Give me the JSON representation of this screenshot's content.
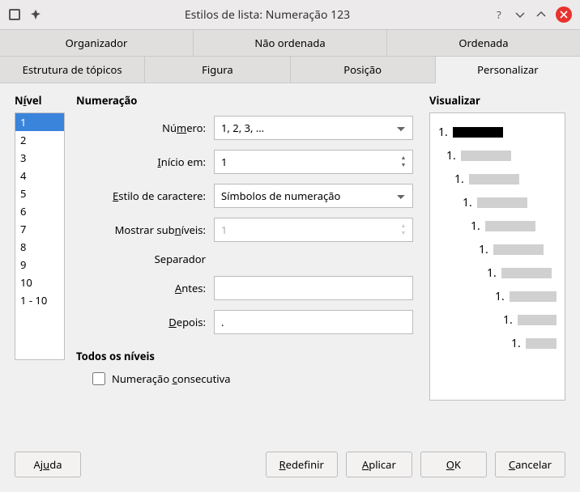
{
  "titlebar": {
    "title": "Estilos de lista: Numeração 123"
  },
  "tabs_row1": [
    {
      "label": "Organizador"
    },
    {
      "label": "Não ordenada"
    },
    {
      "label": "Ordenada"
    }
  ],
  "tabs_row2": [
    {
      "label": "Estrutura de tópicos"
    },
    {
      "label": "Figura"
    },
    {
      "label": "Posição"
    },
    {
      "label": "Personalizar",
      "active": true
    }
  ],
  "level": {
    "header_pre": "N",
    "header_u": "í",
    "header_post": "vel",
    "items": [
      "1",
      "2",
      "3",
      "4",
      "5",
      "6",
      "7",
      "8",
      "9",
      "10",
      "1 - 10"
    ],
    "selected": "1"
  },
  "numbering": {
    "header": "Numeração",
    "number_label_pre": "Nú",
    "number_label_u": "m",
    "number_label_post": "ero:",
    "number_value": "1, 2, 3, …",
    "start_label_pre": "",
    "start_label_u": "I",
    "start_label_post": "nício em:",
    "start_value": "1",
    "charstyle_label_pre": "",
    "charstyle_label_u": "E",
    "charstyle_label_post": "stilo de caractere:",
    "charstyle_value": "Símbolos de numeração",
    "sublevels_label_pre": "Mostrar sub",
    "sublevels_label_u": "n",
    "sublevels_label_post": "íveis:",
    "sublevels_value": "1",
    "separator_label": "Separador",
    "before_label_pre": "",
    "before_label_u": "A",
    "before_label_post": "ntes:",
    "before_value": "",
    "after_label_pre": "",
    "after_label_u": "D",
    "after_label_post": "epois:",
    "after_value": "."
  },
  "all_levels": {
    "header": "Todos os níveis",
    "checkbox_pre": "Numeração ",
    "checkbox_u": "c",
    "checkbox_post": "onsecutiva"
  },
  "preview": {
    "header": "Visualizar",
    "lines": [
      {
        "num": "1.",
        "first": true,
        "indent": 0
      },
      {
        "num": "1.",
        "indent": 1
      },
      {
        "num": "1.",
        "indent": 2
      },
      {
        "num": "1.",
        "indent": 3
      },
      {
        "num": "1.",
        "indent": 4
      },
      {
        "num": "1.",
        "indent": 5
      },
      {
        "num": "1.",
        "indent": 6
      },
      {
        "num": "1.",
        "indent": 7
      },
      {
        "num": "1.",
        "indent": 8
      },
      {
        "num": "1.",
        "indent": 9
      }
    ]
  },
  "footer": {
    "help_pre": "Aj",
    "help_u": "u",
    "help_post": "da",
    "reset_u": "R",
    "reset_post": "edefinir",
    "apply_u": "A",
    "apply_post": "plicar",
    "ok_u": "O",
    "ok_post": "K",
    "cancel_u": "C",
    "cancel_post": "ancelar"
  }
}
